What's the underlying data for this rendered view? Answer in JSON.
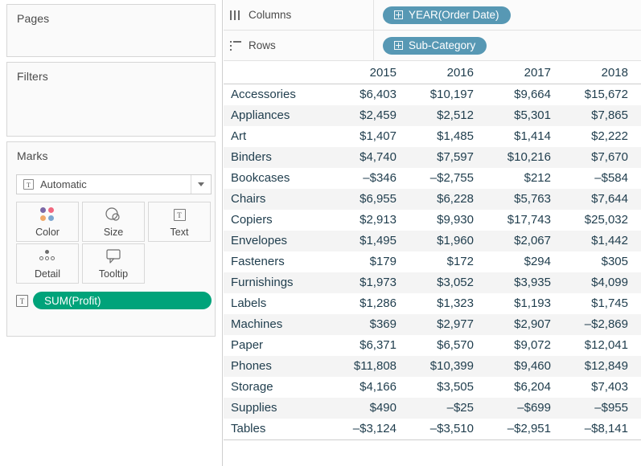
{
  "left_panel": {
    "pages": {
      "title": "Pages"
    },
    "filters": {
      "title": "Filters"
    },
    "marks": {
      "title": "Marks",
      "type_selector": {
        "label": "Automatic",
        "glyph": "T",
        "icon": "text-mark-icon",
        "caret_icon": "chevron-down-icon"
      },
      "buttons": [
        {
          "label": "Color",
          "icon": "color-dots-icon"
        },
        {
          "label": "Size",
          "icon": "size-circles-icon"
        },
        {
          "label": "Text",
          "icon": "text-box-icon",
          "glyph": "T"
        },
        {
          "label": "Detail",
          "icon": "detail-dots-icon"
        },
        {
          "label": "Tooltip",
          "icon": "tooltip-bubble-icon"
        }
      ],
      "pill": {
        "label": "SUM(Profit)",
        "prefix_glyph": "T",
        "color": "#00a37a"
      }
    }
  },
  "shelves": [
    {
      "name": "Columns",
      "icon": "columns-icon",
      "pill": {
        "label": "YEAR(Order Date)",
        "color": "#5798b4",
        "expand_icon": "plus-box-icon"
      }
    },
    {
      "name": "Rows",
      "icon": "rows-icon",
      "pill": {
        "label": "Sub-Category",
        "color": "#5798b4",
        "expand_icon": "plus-box-icon"
      }
    }
  ],
  "crosstab": {
    "corner_label": "",
    "columns": [
      "2015",
      "2016",
      "2017",
      "2018"
    ],
    "rows": [
      {
        "label": "Accessories",
        "values": [
          "$6,403",
          "$10,197",
          "$9,664",
          "$15,672"
        ]
      },
      {
        "label": "Appliances",
        "values": [
          "$2,459",
          "$2,512",
          "$5,301",
          "$7,865"
        ]
      },
      {
        "label": "Art",
        "values": [
          "$1,407",
          "$1,485",
          "$1,414",
          "$2,222"
        ]
      },
      {
        "label": "Binders",
        "values": [
          "$4,740",
          "$7,597",
          "$10,216",
          "$7,670"
        ]
      },
      {
        "label": "Bookcases",
        "values": [
          "–$346",
          "–$2,755",
          "$212",
          "–$584"
        ]
      },
      {
        "label": "Chairs",
        "values": [
          "$6,955",
          "$6,228",
          "$5,763",
          "$7,644"
        ]
      },
      {
        "label": "Copiers",
        "values": [
          "$2,913",
          "$9,930",
          "$17,743",
          "$25,032"
        ]
      },
      {
        "label": "Envelopes",
        "values": [
          "$1,495",
          "$1,960",
          "$2,067",
          "$1,442"
        ]
      },
      {
        "label": "Fasteners",
        "values": [
          "$179",
          "$172",
          "$294",
          "$305"
        ]
      },
      {
        "label": "Furnishings",
        "values": [
          "$1,973",
          "$3,052",
          "$3,935",
          "$4,099"
        ]
      },
      {
        "label": "Labels",
        "values": [
          "$1,286",
          "$1,323",
          "$1,193",
          "$1,745"
        ]
      },
      {
        "label": "Machines",
        "values": [
          "$369",
          "$2,977",
          "$2,907",
          "–$2,869"
        ]
      },
      {
        "label": "Paper",
        "values": [
          "$6,371",
          "$6,570",
          "$9,072",
          "$12,041"
        ]
      },
      {
        "label": "Phones",
        "values": [
          "$11,808",
          "$10,399",
          "$9,460",
          "$12,849"
        ]
      },
      {
        "label": "Storage",
        "values": [
          "$4,166",
          "$3,505",
          "$6,204",
          "$7,403"
        ]
      },
      {
        "label": "Supplies",
        "values": [
          "$490",
          "–$25",
          "–$699",
          "–$955"
        ]
      },
      {
        "label": "Tables",
        "values": [
          "–$3,124",
          "–$3,510",
          "–$2,951",
          "–$8,141"
        ]
      }
    ]
  }
}
